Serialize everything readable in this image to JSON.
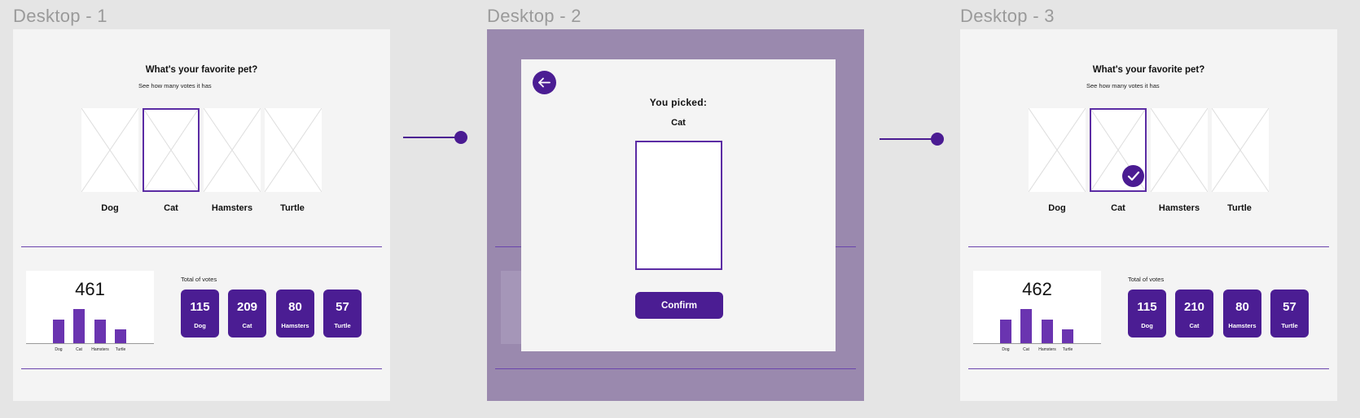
{
  "frames": {
    "frame1_title": "Desktop - 1",
    "frame2_title": "Desktop - 2",
    "frame3_title": "Desktop - 3"
  },
  "poll": {
    "question": "What's your favorite pet?",
    "subtitle": "See how many votes it has",
    "pets": [
      "Dog",
      "Cat",
      "Hamsters",
      "Turtle"
    ],
    "total_label": "Total of votes"
  },
  "results_before": {
    "total": "461",
    "votes": [
      "115",
      "209",
      "80",
      "57"
    ]
  },
  "results_after": {
    "total": "462",
    "votes": [
      "115",
      "210",
      "80",
      "57"
    ]
  },
  "mini_chart_labels": [
    "Dog",
    "Cat",
    "Hamsters",
    "Turtle"
  ],
  "confirm_dialog": {
    "picked_label": "You  picked:",
    "picked_name": "Cat",
    "confirm_label": "Confirm"
  },
  "colors": {
    "accent": "#4b1d93",
    "accent_border": "#5b2ca4",
    "overlay": "#9a89ae",
    "frame_bg": "#f4f4f4"
  },
  "icons": {
    "back": "arrow-left-icon",
    "check": "checkmark-icon",
    "placeholder": "image-placeholder-icon"
  }
}
